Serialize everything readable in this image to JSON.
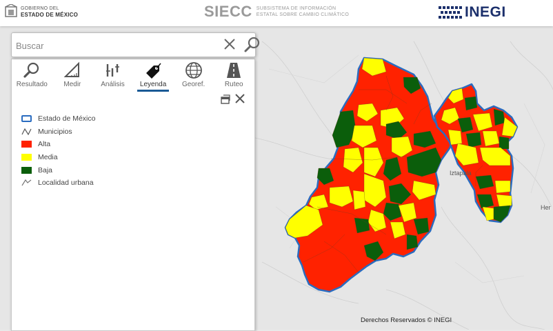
{
  "header": {
    "gov_line1": "GOBIERNO DEL",
    "gov_line2": "ESTADO DE MÉXICO",
    "siecc_title": "SIECC",
    "siecc_sub1": "SUBSISTEMA DE INFORMACIÓN",
    "siecc_sub2": "ESTATAL SOBRE CAMBIO CLIMÁTICO",
    "inegi_label": "INEGI"
  },
  "search": {
    "placeholder": "Buscar",
    "value": ""
  },
  "toolbar": {
    "tools": [
      {
        "label": "Resultado",
        "icon": "magnifier-icon"
      },
      {
        "label": "Medir",
        "icon": "ruler-icon"
      },
      {
        "label": "Análisis",
        "icon": "analysis-icon"
      },
      {
        "label": "Leyenda",
        "icon": "legend-tag-icon",
        "active": true
      },
      {
        "label": "Georef.",
        "icon": "globe-icon"
      },
      {
        "label": "Ruteo",
        "icon": "road-icon"
      }
    ]
  },
  "legend": {
    "items": [
      {
        "label": "Estado de México",
        "symbol": "outline",
        "color": "#2a6cc0"
      },
      {
        "label": "Municipios",
        "symbol": "line",
        "color": "#555555"
      },
      {
        "label": "Alta",
        "symbol": "fill",
        "color": "#ff2200"
      },
      {
        "label": "Media",
        "symbol": "fill",
        "color": "#ffff00"
      },
      {
        "label": "Baja",
        "symbol": "fill",
        "color": "#0b5e0b"
      },
      {
        "label": "Localidad urbana",
        "symbol": "line",
        "color": "#777777"
      }
    ]
  },
  "map": {
    "place_labels": [
      "Iztapala",
      "Her"
    ],
    "copyright": "Derechos Reservados © INEGI"
  },
  "colors": {
    "alta": "#ff2200",
    "media": "#ffff00",
    "baja": "#0b5e0b",
    "state_outline": "#2a6cc0",
    "accent": "#1a5a95"
  }
}
